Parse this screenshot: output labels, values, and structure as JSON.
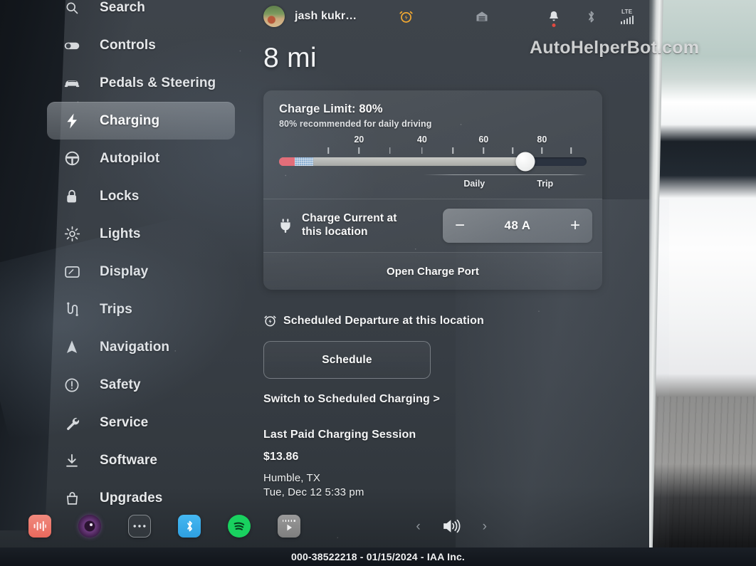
{
  "statusbar": {
    "profile_name": "jash kukr…",
    "icons": [
      {
        "name": "alarm-icon",
        "label": "alarm"
      },
      {
        "name": "garage-icon",
        "label": "garage"
      },
      {
        "name": "notification-bell-icon",
        "label": "notifications"
      },
      {
        "name": "bluetooth-icon",
        "label": "bluetooth"
      },
      {
        "name": "lte-signal-icon",
        "label": "LTE"
      }
    ],
    "lte_label": "LTE"
  },
  "watermark": "AutoHelperBot.com",
  "sidebar": {
    "items": [
      {
        "label": "Search",
        "icon": "search-icon",
        "active": false
      },
      {
        "label": "Controls",
        "icon": "toggle-switch-icon",
        "active": false
      },
      {
        "label": "Pedals & Steering",
        "icon": "car-icon",
        "active": false
      },
      {
        "label": "Charging",
        "icon": "lightning-bolt-icon",
        "active": true
      },
      {
        "label": "Autopilot",
        "icon": "steering-wheel-icon",
        "active": false
      },
      {
        "label": "Locks",
        "icon": "lock-icon",
        "active": false
      },
      {
        "label": "Lights",
        "icon": "sun-brightness-icon",
        "active": false
      },
      {
        "label": "Display",
        "icon": "display-screen-icon",
        "active": false
      },
      {
        "label": "Trips",
        "icon": "winding-road-icon",
        "active": false
      },
      {
        "label": "Navigation",
        "icon": "navigation-arrow-icon",
        "active": false
      },
      {
        "label": "Safety",
        "icon": "exclamation-circle-icon",
        "active": false
      },
      {
        "label": "Service",
        "icon": "wrench-icon",
        "active": false
      },
      {
        "label": "Software",
        "icon": "download-icon",
        "active": false
      },
      {
        "label": "Upgrades",
        "icon": "shopping-bag-icon",
        "active": false
      }
    ]
  },
  "main": {
    "range": "8 mi",
    "charge_limit": {
      "title": "Charge Limit: 80%",
      "subtitle": "80% recommended for daily driving",
      "value": 80,
      "tick_labels": [
        "20",
        "40",
        "60",
        "80"
      ],
      "tick_values": [
        20,
        40,
        60,
        80
      ],
      "mode_daily": "Daily",
      "mode_trip": "Trip"
    },
    "charge_current": {
      "label_line1": "Charge Current at",
      "label_line2": "this location",
      "value": "48 A",
      "minus": "−",
      "plus": "+"
    },
    "open_charge_port": "Open Charge Port",
    "scheduled": {
      "heading": "Scheduled Departure at this location",
      "button": "Schedule",
      "switch_link": "Switch to Scheduled Charging >"
    },
    "last_session": {
      "heading": "Last Paid Charging Session",
      "amount": "$13.86",
      "location": "Humble, TX",
      "datetime": "Tue, Dec 12 5:33 pm"
    }
  },
  "dock": {
    "apps": [
      {
        "name": "audio-app-icon",
        "label": "Audio"
      },
      {
        "name": "camera-app-icon",
        "label": "Camera"
      },
      {
        "name": "more-apps-icon",
        "label": "More"
      },
      {
        "name": "bluetooth-app-icon",
        "label": "Bluetooth"
      },
      {
        "name": "spotify-app-icon",
        "label": "Spotify"
      },
      {
        "name": "media-player-app-icon",
        "label": "Media"
      }
    ],
    "prev": "‹",
    "next": "›",
    "volume": "volume-icon"
  },
  "caption": "000-38522218 - 01/15/2024 - IAA Inc.",
  "colors": {
    "accent_blue": "#45b8f2",
    "spotify_green": "#19d15f",
    "alarm_orange": "#f0a832",
    "notification_red": "#e1493f",
    "slider_red": "#ef6a74",
    "slider_blue": "#8fb4d8",
    "panel_bg": "#3b4148"
  }
}
